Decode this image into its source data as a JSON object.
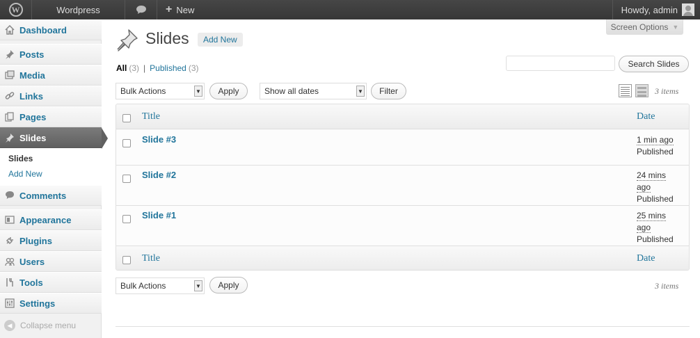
{
  "adminbar": {
    "site_name": "Wordpress",
    "new_label": "New",
    "howdy": "Howdy, admin"
  },
  "sidebar": {
    "items": [
      {
        "label": "Dashboard",
        "icon": "home-icon"
      },
      {
        "label": "Posts",
        "icon": "pin-icon"
      },
      {
        "label": "Media",
        "icon": "media-icon"
      },
      {
        "label": "Links",
        "icon": "link-icon"
      },
      {
        "label": "Pages",
        "icon": "pages-icon"
      },
      {
        "label": "Slides",
        "icon": "pin-icon"
      },
      {
        "label": "Comments",
        "icon": "comment-icon"
      },
      {
        "label": "Appearance",
        "icon": "appearance-icon"
      },
      {
        "label": "Plugins",
        "icon": "plugin-icon"
      },
      {
        "label": "Users",
        "icon": "users-icon"
      },
      {
        "label": "Tools",
        "icon": "tools-icon"
      },
      {
        "label": "Settings",
        "icon": "settings-icon"
      }
    ],
    "submenu": [
      {
        "label": "Slides"
      },
      {
        "label": "Add New"
      }
    ],
    "collapse_label": "Collapse menu"
  },
  "screen_options": "Screen Options",
  "header": {
    "title": "Slides",
    "add_new": "Add New"
  },
  "filters": {
    "all_label": "All",
    "all_count": "(3)",
    "published_label": "Published",
    "published_count": "(3)"
  },
  "search": {
    "button": "Search Slides"
  },
  "tablenav": {
    "bulk_actions": "Bulk Actions",
    "apply": "Apply",
    "dates": "Show all dates",
    "filter": "Filter",
    "items_count": "3 items"
  },
  "table": {
    "col_title": "Title",
    "col_date": "Date",
    "rows": [
      {
        "title": "Slide #3",
        "date_line1": "1 min ago",
        "date_line2": "",
        "status": "Published"
      },
      {
        "title": "Slide #2",
        "date_line1": "24 mins",
        "date_line2": "ago",
        "status": "Published"
      },
      {
        "title": "Slide #1",
        "date_line1": "25 mins",
        "date_line2": "ago",
        "status": "Published"
      }
    ]
  },
  "colors": {
    "link": "#21759b",
    "adminbar": "#464646",
    "active_menu": "#6d6d6d"
  }
}
